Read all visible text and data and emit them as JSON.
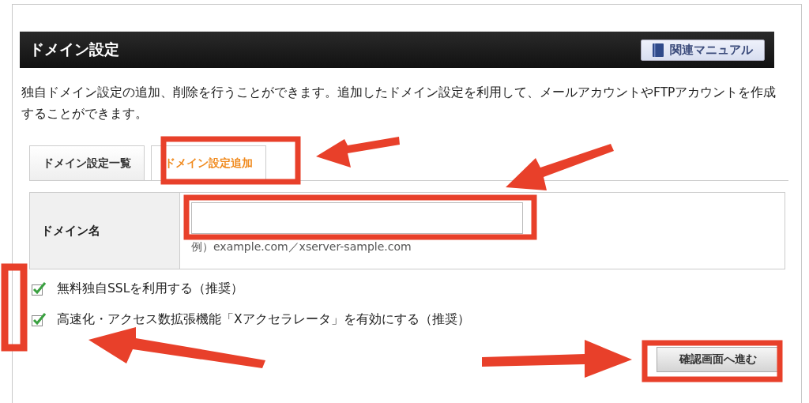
{
  "header": {
    "title": "ドメイン設定",
    "manual_button": "関連マニュアル"
  },
  "description": "独自ドメイン設定の追加、削除を行うことができます。追加したドメイン設定を利用して、メールアカウントやFTPアカウントを作成することができます。",
  "tabs": [
    {
      "label": "ドメイン設定一覧",
      "selected": false
    },
    {
      "label": "ドメイン設定追加",
      "selected": true
    }
  ],
  "form": {
    "label": "ドメイン名",
    "example": "例）example.com／xserver-sample.com"
  },
  "options": [
    {
      "label": "無料独自SSLを利用する（推奨）",
      "checked": true
    },
    {
      "label": "高速化・アクセス数拡張機能「Xアクセラレータ」を有効にする（推奨）",
      "checked": true
    }
  ],
  "submit": "確認画面へ進む"
}
